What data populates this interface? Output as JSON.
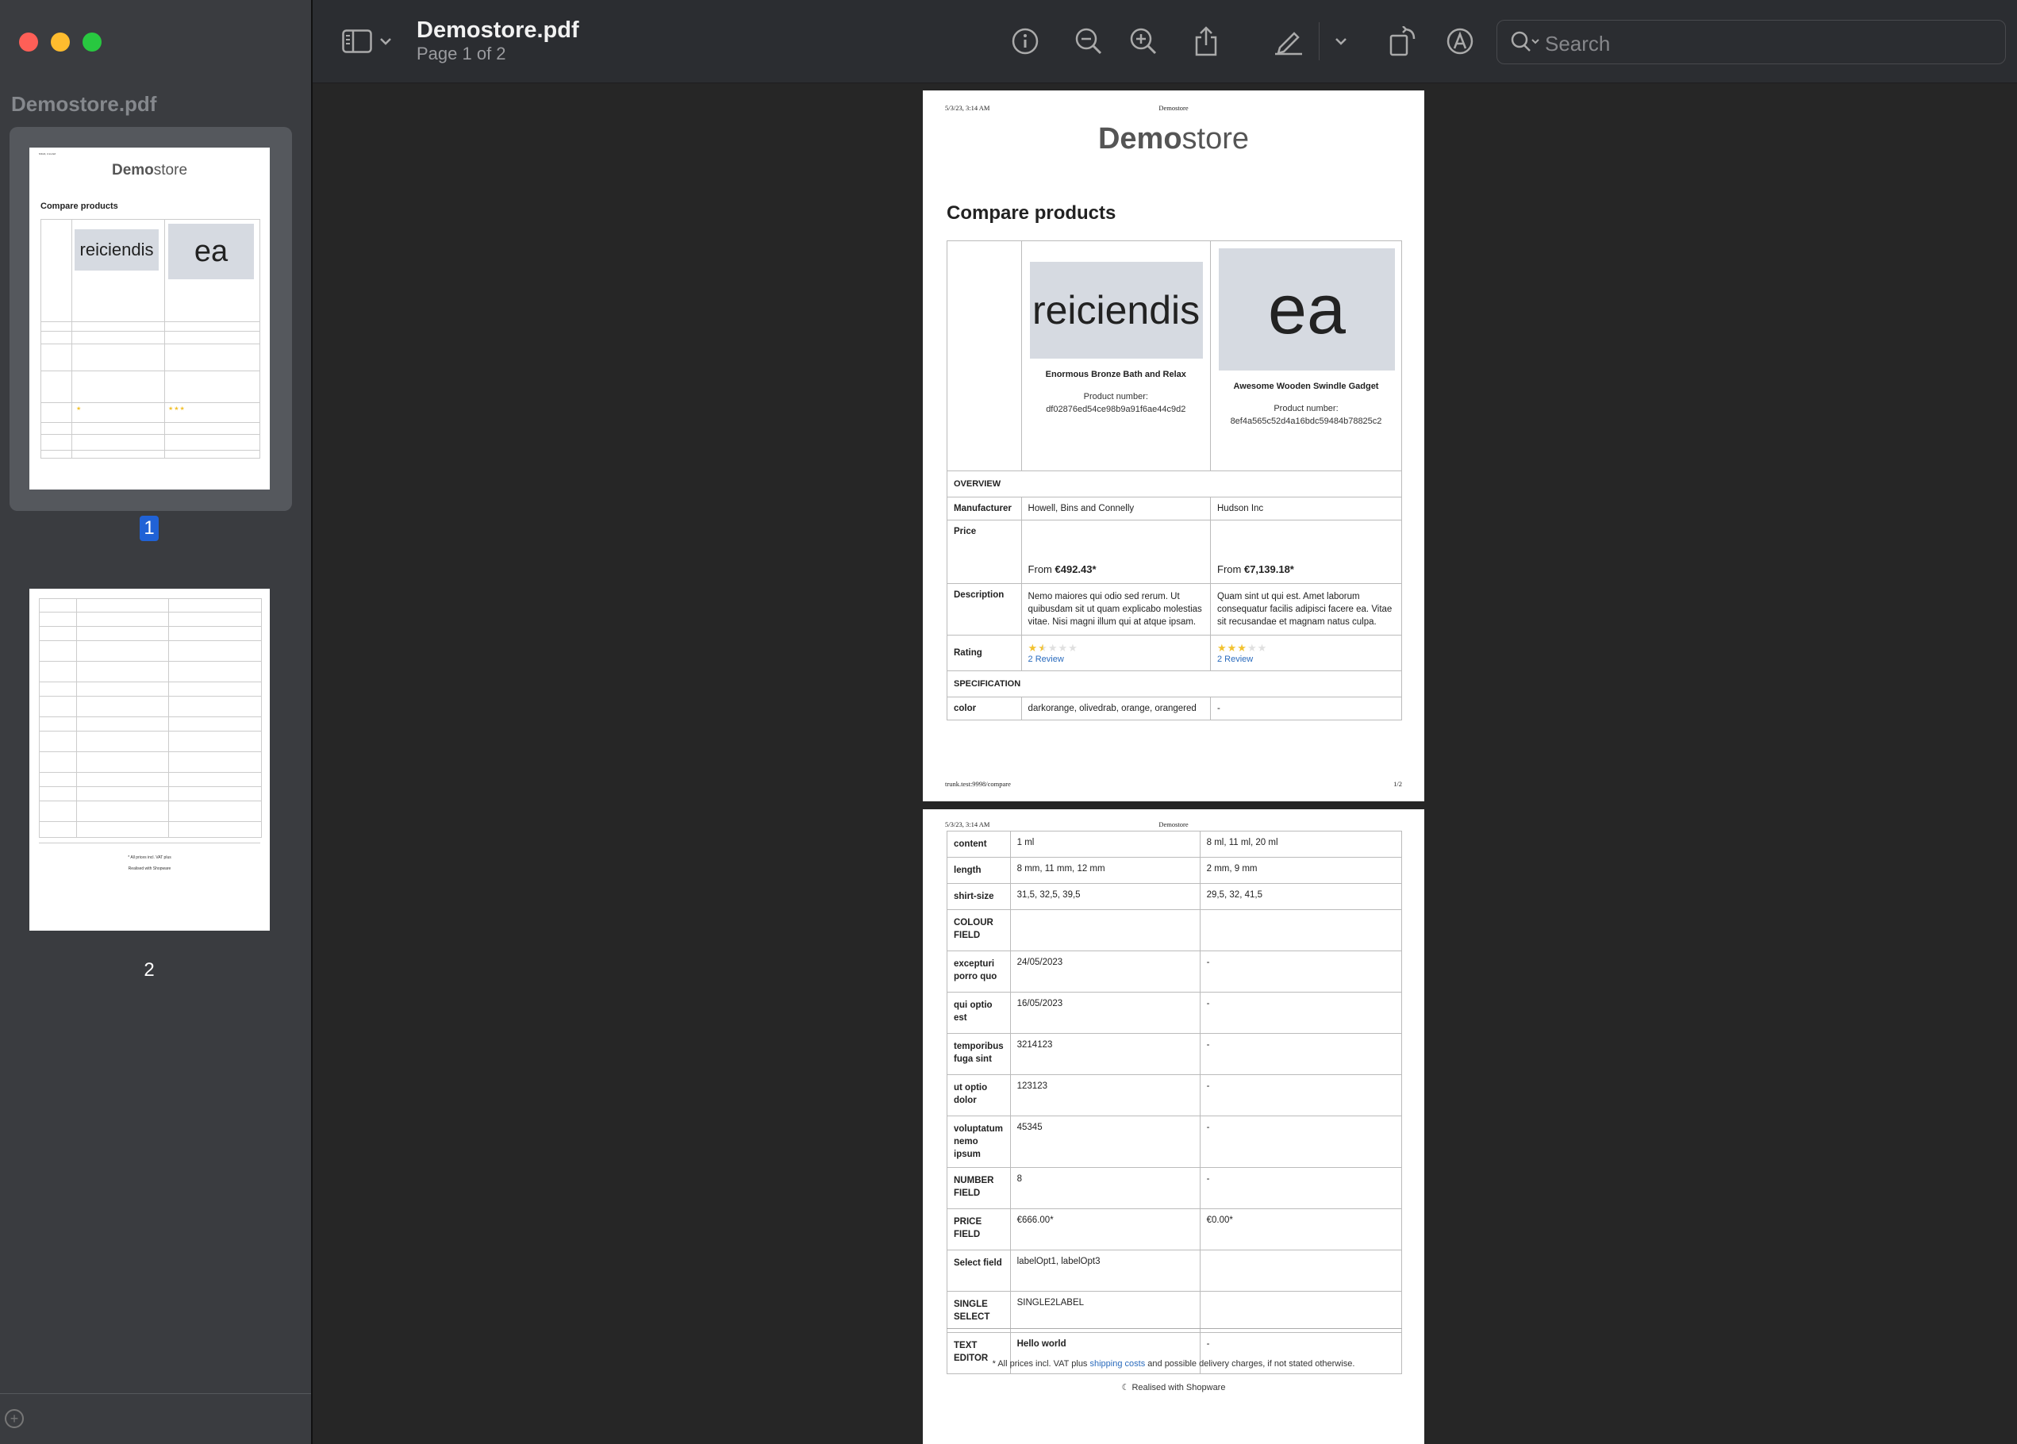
{
  "window": {
    "title": "Demostore.pdf",
    "subtitle": "Page 1 of 2"
  },
  "sidebar": {
    "title": "Demostore.pdf",
    "pages": [
      "1",
      "2"
    ],
    "selected": "1"
  },
  "toolbar": {
    "icons": [
      "sidebar-toggle-icon",
      "chevron-down-icon",
      "info-icon",
      "zoom-out-icon",
      "zoom-in-icon",
      "share-icon",
      "highlight-pen-icon",
      "chevron-down-icon",
      "rotate-icon",
      "markup-icon",
      "search-icon"
    ],
    "search_placeholder": "Search"
  },
  "doc": {
    "header_date": "5/3/23, 3:14 AM",
    "header_site": "Demostore",
    "logo_bold": "Demo",
    "logo_rest": "store",
    "title": "Compare products",
    "products": [
      {
        "image_text": "reiciendis",
        "name": "Enormous Bronze Bath and Relax",
        "number_label": "Product number:",
        "number": "df02876ed54ce98b9a91f6ae44c9d2"
      },
      {
        "image_text": "ea",
        "name": "Awesome Wooden Swindle Gadget",
        "number_label": "Product number:",
        "number": "8ef4a565c52d4a16bdc59484b78825c2"
      }
    ],
    "overview_label": "OVERVIEW",
    "manufacturer_label": "Manufacturer",
    "manufacturers": [
      "Howell, Bins and Connelly",
      "Hudson Inc"
    ],
    "price_label": "Price",
    "price_prefix": "From",
    "prices": [
      "€492.43*",
      "€7,139.18*"
    ],
    "description_label": "Description",
    "descriptions": [
      "Nemo maiores qui odio sed rerum. Ut quibusdam sit ut quam explicabo molestias vitae. Nisi magni illum qui at atque ipsam.",
      "Quam sint ut qui est. Amet laborum consequatur facilis adipisci facere ea. Vitae sit recusandae et magnam natus culpa."
    ],
    "rating_label": "Rating",
    "ratings": [
      1.5,
      3
    ],
    "reviews": [
      "2 Review",
      "2 Review"
    ],
    "specification_label": "SPECIFICATION",
    "color_label": "color",
    "colors": [
      "darkorange, olivedrab, orange, orangered",
      "-"
    ],
    "footer_url": "trunk.test:9998/compare",
    "footer_page": "1/2",
    "page2_rows": [
      {
        "label": "content",
        "a": "1 ml",
        "b": "8 ml, 11 ml, 20 ml"
      },
      {
        "label": "length",
        "a": "8 mm, 11 mm, 12 mm",
        "b": "2 mm, 9 mm"
      },
      {
        "label": "shirt-size",
        "a": "31,5, 32,5, 39,5",
        "b": "29,5, 32, 41,5"
      },
      {
        "label": "COLOUR FIELD",
        "a": "",
        "b": ""
      },
      {
        "label": "excepturi porro quo",
        "a": "24/05/2023",
        "b": "-"
      },
      {
        "label": "qui optio est",
        "a": "16/05/2023",
        "b": "-"
      },
      {
        "label": "temporibus fuga sint",
        "a": "3214123",
        "b": "-"
      },
      {
        "label": "ut optio dolor",
        "a": "123123",
        "b": "-"
      },
      {
        "label": "voluptatum nemo ipsum",
        "a": "45345",
        "b": "-"
      },
      {
        "label": "NUMBER FIELD",
        "a": "8",
        "b": "-"
      },
      {
        "label": "PRICE FIELD",
        "a": "€666.00*",
        "b": "€0.00*"
      },
      {
        "label": "Select field",
        "a": "labelOpt1, labelOpt3",
        "b": ""
      },
      {
        "label": "SINGLE SELECT",
        "a": "SINGLE2LABEL",
        "b": ""
      },
      {
        "label": "TEXT EDITOR",
        "a": "Hello world",
        "b": "-"
      }
    ],
    "vat_note_pre": "* All prices incl. VAT plus",
    "vat_note_link": "shipping costs",
    "vat_note_post": "and possible delivery charges, if not stated otherwise.",
    "shopware_note": "Realised with Shopware"
  }
}
